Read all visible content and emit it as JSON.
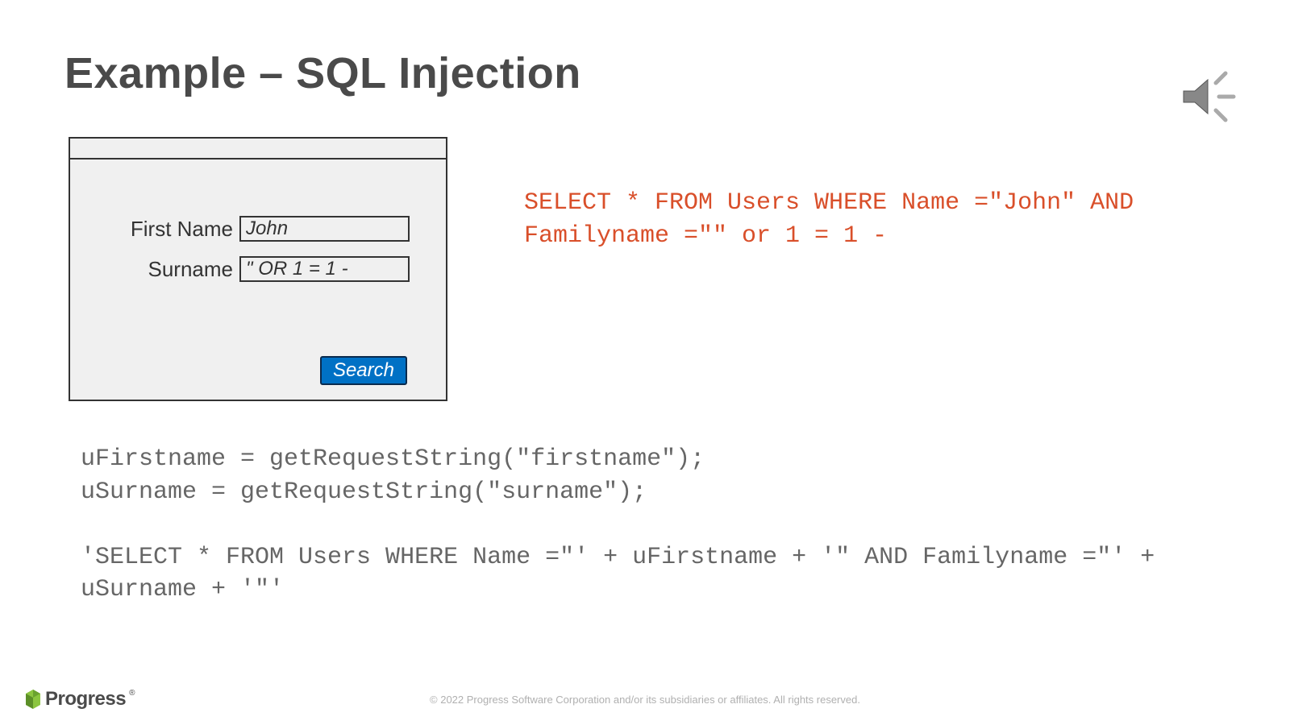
{
  "slide": {
    "title": "Example – SQL Injection"
  },
  "form": {
    "first_name_label": "First Name",
    "first_name_value": "John",
    "surname_label": "Surname",
    "surname_value": "\" OR 1 = 1 -",
    "search_button": "Search"
  },
  "sql_result": "SELECT * FROM Users WHERE Name =\"John\" AND Familyname =\"\" or 1 = 1 -",
  "code": "uFirstname = getRequestString(\"firstname\");\nuSurname = getRequestString(\"surname\");\n\n'SELECT * FROM Users WHERE Name =\"' + uFirstname + '\" AND Familyname =\"' + uSurname + '\"'",
  "footer": {
    "logo_text": "Progress",
    "copyright": "© 2022 Progress Software Corporation and/or its subsidiaries or affiliates. All rights reserved."
  },
  "icons": {
    "audio": "audio-icon",
    "logo_mark": "progress-logo-mark"
  }
}
